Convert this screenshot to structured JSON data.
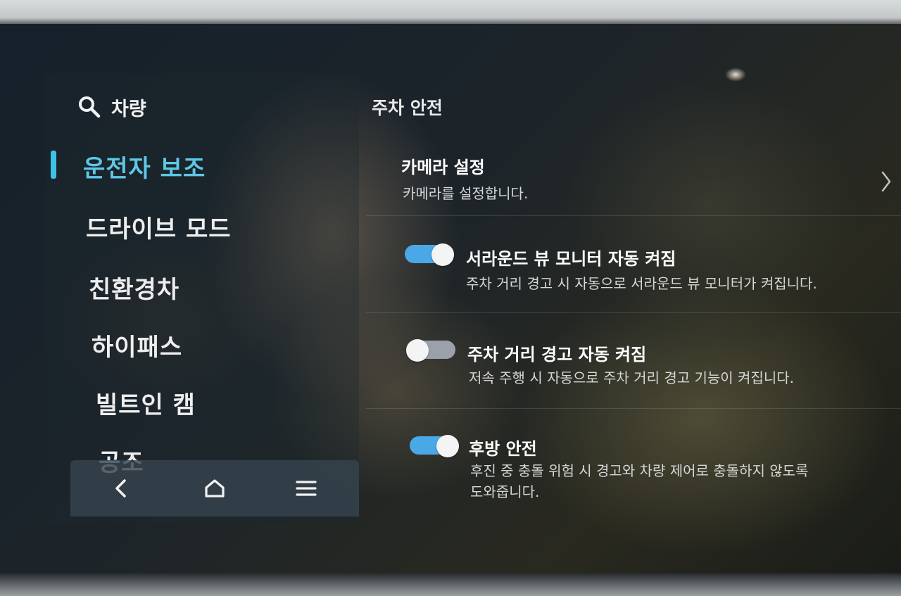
{
  "header": {
    "title": "차량"
  },
  "section": {
    "title": "주차 안전"
  },
  "sidebar": {
    "items": [
      {
        "label": "운전자 보조",
        "active": true
      },
      {
        "label": "드라이브 모드",
        "active": false
      },
      {
        "label": "친환경차",
        "active": false
      },
      {
        "label": "하이패스",
        "active": false
      },
      {
        "label": "빌트인 캠",
        "active": false
      },
      {
        "label": "공조",
        "active": false
      }
    ]
  },
  "settings": [
    {
      "title": "카메라 설정",
      "description": "카메라를 설정합니다.",
      "kind": "link"
    },
    {
      "title": "서라운드 뷰 모니터 자동 켜짐",
      "description": "주차 거리 경고 시 자동으로 서라운드 뷰 모니터가 켜집니다.",
      "kind": "toggle",
      "on": true
    },
    {
      "title": "주차 거리 경고 자동 켜짐",
      "description": "저속 주행 시 자동으로 주차 거리 경고 기능이 켜집니다.",
      "kind": "toggle",
      "on": false
    },
    {
      "title": "후방 안전",
      "description_line1": "후진 중 충돌 위험 시 경고와 차량 제어로 충돌하지 않도록",
      "description_line2": "도와줍니다.",
      "kind": "toggle",
      "on": true
    }
  ],
  "navbar": {
    "icons": [
      "back-icon",
      "home-icon",
      "menu-icon"
    ]
  },
  "colors": {
    "accent": "#5ec8e6",
    "toggle_on": "#4aa8e6",
    "toggle_off": "#9aa1ab"
  }
}
